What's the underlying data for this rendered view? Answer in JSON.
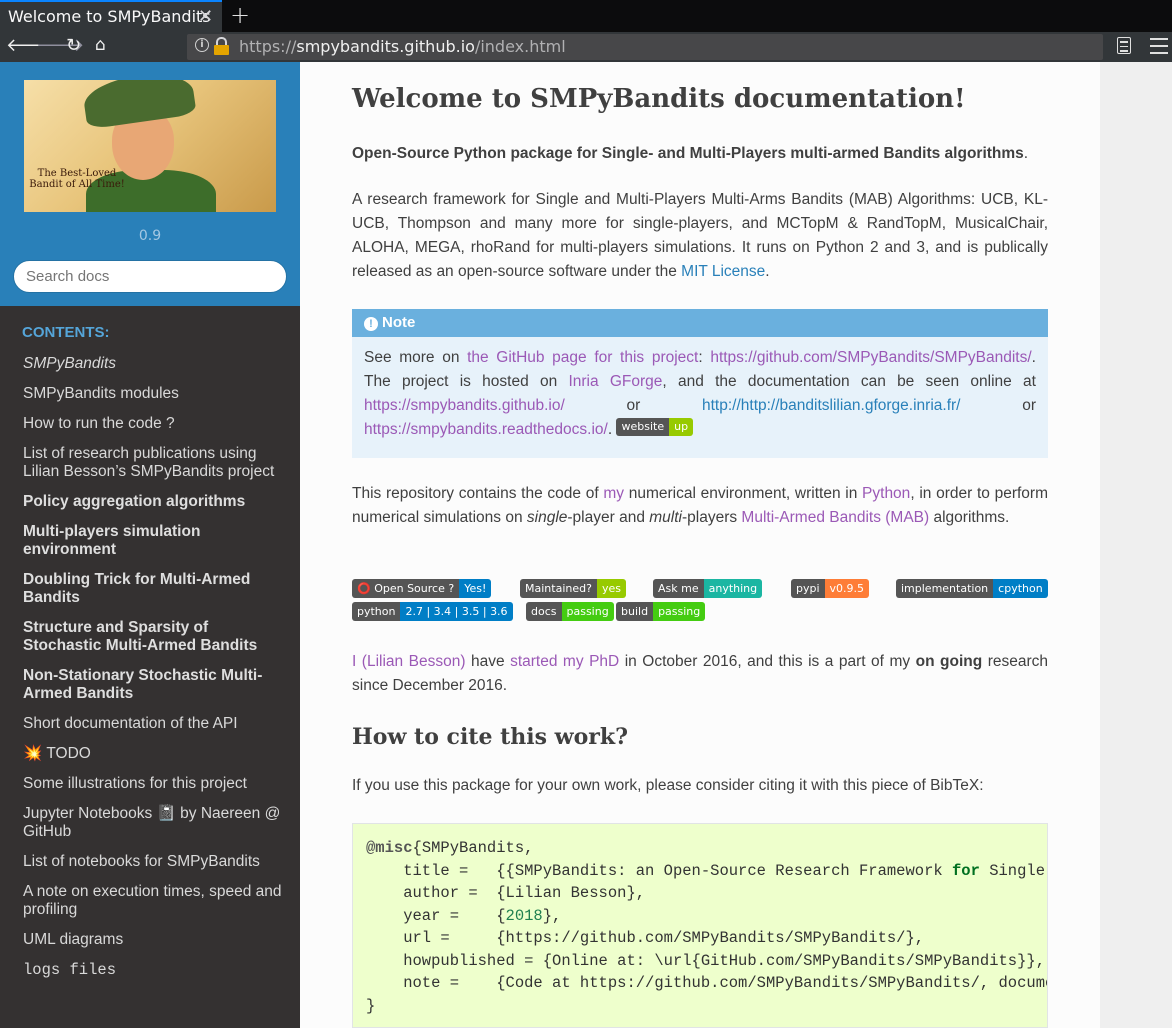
{
  "browser": {
    "tab_title": "Welcome to SMPyBandits",
    "url_prefix": "https://",
    "url_host": "smpybandits.github.io",
    "url_path": "/index.html"
  },
  "sidebar": {
    "logo_text": "The Best-Loved Bandit of All Time!",
    "version": "0.9",
    "search_placeholder": "Search docs",
    "contents_caption": "CONTENTS:",
    "items": [
      {
        "label": "SMPyBandits",
        "style": "italic"
      },
      {
        "label": "SMPyBandits modules",
        "style": "normal"
      },
      {
        "label": "How to run the code ?",
        "style": "normal"
      },
      {
        "label": "List of research publications using Lilian Besson’s SMPyBandits project",
        "style": "normal"
      },
      {
        "label": "Policy aggregation algorithms",
        "style": "bold"
      },
      {
        "label": "Multi-players simulation environment",
        "style": "bold"
      },
      {
        "label": "Doubling Trick for Multi-Armed Bandits",
        "style": "bold"
      },
      {
        "label": "Structure and Sparsity of Stochastic Multi-Armed Bandits",
        "style": "bold"
      },
      {
        "label": "Non-Stationary Stochastic Multi-Armed Bandits",
        "style": "bold"
      },
      {
        "label": "Short documentation of the API",
        "style": "normal"
      },
      {
        "label": "💥 TODO",
        "style": "normal"
      },
      {
        "label": "Some illustrations for this project",
        "style": "normal"
      },
      {
        "label": "Jupyter Notebooks 📓 by Naereen @ GitHub",
        "style": "normal"
      },
      {
        "label": "List of notebooks for SMPyBandits",
        "style": "normal"
      },
      {
        "label": "A note on execution times, speed and profiling",
        "style": "normal"
      },
      {
        "label": "UML diagrams",
        "style": "normal"
      },
      {
        "label": "logs files",
        "style": "mono"
      }
    ]
  },
  "main": {
    "title": "Welcome to SMPyBandits documentation!",
    "subtitle_bold": "Open-Source Python package for Single- and Multi-Players multi-armed Bandits algorithms",
    "subtitle_end": ".",
    "intro_text": "A research framework for Single and Multi-Players Multi-Arms Bandits (MAB) Algorithms: UCB, KL-UCB, Thompson and many more for single-players, and MCTopM & RandTopM, MusicalChair, ALOHA, MEGA, rhoRand for multi-players simulations. It runs on Python 2 and 3, and is publically released as an open-source software under the ",
    "intro_link": "MIT License",
    "intro_end": ".",
    "note": {
      "heading": "Note",
      "t1": "See more on ",
      "l1": "the GitHub page for this project",
      "t2": ": ",
      "l2": "https://github.com/SMPyBandits/SMPyBandits/",
      "t3": ". The project is hosted on ",
      "l3": "Inria GForge",
      "t4": ", and the documentation can be seen online at ",
      "l4": "https://smpybandits.github.io/",
      "t5": " or ",
      "l5": "http://http://banditslilian.gforge.inria.fr/",
      "t6": " or ",
      "l6": "https://smpybandits.readthedocs.io/",
      "t7": ". ",
      "badge_left": "website",
      "badge_right": "up"
    },
    "repo": {
      "t1": "This repository contains the code of ",
      "l1": "my",
      "t2": " numerical environment, written in ",
      "l2": "Python",
      "t3": ", in order to perform numerical simulations on ",
      "i1": "single",
      "t4": "-player and ",
      "i2": "multi",
      "t5": "-players ",
      "l3": "Multi-Armed Bandits (MAB)",
      "t6": " algorithms."
    },
    "badges_row1": [
      {
        "left": "⭕ Open Source ?",
        "right": "Yes!",
        "color": "#007ec6"
      },
      {
        "left": "Maintained?",
        "right": "yes",
        "color": "#97ca00"
      },
      {
        "left": "Ask me",
        "right": "anything",
        "color": "#1bb6a2"
      },
      {
        "left": "pypi",
        "right": "v0.9.5",
        "color": "#fe7d37"
      },
      {
        "left": "implementation",
        "right": "cpython",
        "color": "#007ec6"
      }
    ],
    "badges_row2": [
      {
        "left": "python",
        "right": "2.7 | 3.4 | 3.5 | 3.6",
        "color": "#007ec6"
      },
      {
        "left": "docs",
        "right": "passing",
        "color": "#4c1"
      },
      {
        "left": "build",
        "right": "passing",
        "color": "#4c1"
      }
    ],
    "phd": {
      "l1": "I (Lilian Besson)",
      "t1": " have ",
      "l2": "started my PhD",
      "t2": " in October 2016, and this is a part of my ",
      "b1": "on going",
      "t3": " research since December 2016."
    },
    "cite_title": "How to cite this work?",
    "cite_text": "If you use this package for your own work, please consider citing it with this piece of BibTeX:",
    "bibtex": {
      "l1_at": "@misc",
      "l1_rest": "{SMPyBandits,",
      "l2_a": "    title =   {{SMPyBandits: an Open-Source Research Framework ",
      "l2_kw": "for",
      "l2_b": " Single and Multi-Players",
      "l3": "    author =  {Lilian Besson},",
      "l4_a": "    year =    {",
      "l4_num": "2018",
      "l4_b": "},",
      "l5": "    url =     {https://github.com/SMPyBandits/SMPyBandits/},",
      "l6": "    howpublished = {Online at: \\url{GitHub.com/SMPyBandits/SMPyBandits}},",
      "l7": "    note =    {Code at https://github.com/SMPyBandits/SMPyBandits/, documentation at https://smpybandits.github.io/}",
      "l8": "}"
    }
  }
}
